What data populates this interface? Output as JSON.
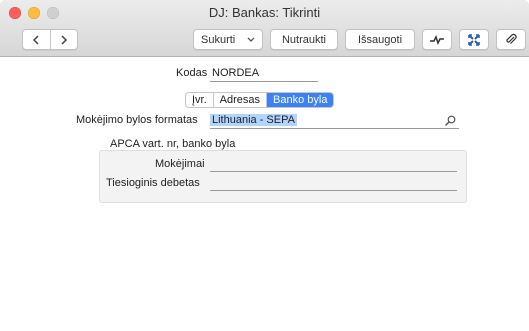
{
  "window": {
    "title": "DJ: Bankas: Tikrinti"
  },
  "toolbar": {
    "create_label": "Sukurti",
    "cancel_label": "Nutraukti",
    "save_label": "Išsaugoti"
  },
  "form": {
    "code_label": "Kodas",
    "code_value": "NORDEA",
    "tabs": [
      "Įvr.",
      "Adresas",
      "Banko byla"
    ],
    "active_tab": "Banko byla",
    "format_label": "Mokėjimo bylos formatas",
    "format_value": "Lithuania - SEPA",
    "apca_label": "APCA vart. nr, banko byla",
    "payments_label": "Mokėjimai",
    "payments_value": "",
    "direct_debit_label": "Tiesioginis debetas",
    "direct_debit_value": ""
  },
  "colors": {
    "accent": "#3b82f6",
    "selection": "#b3d4fd"
  }
}
